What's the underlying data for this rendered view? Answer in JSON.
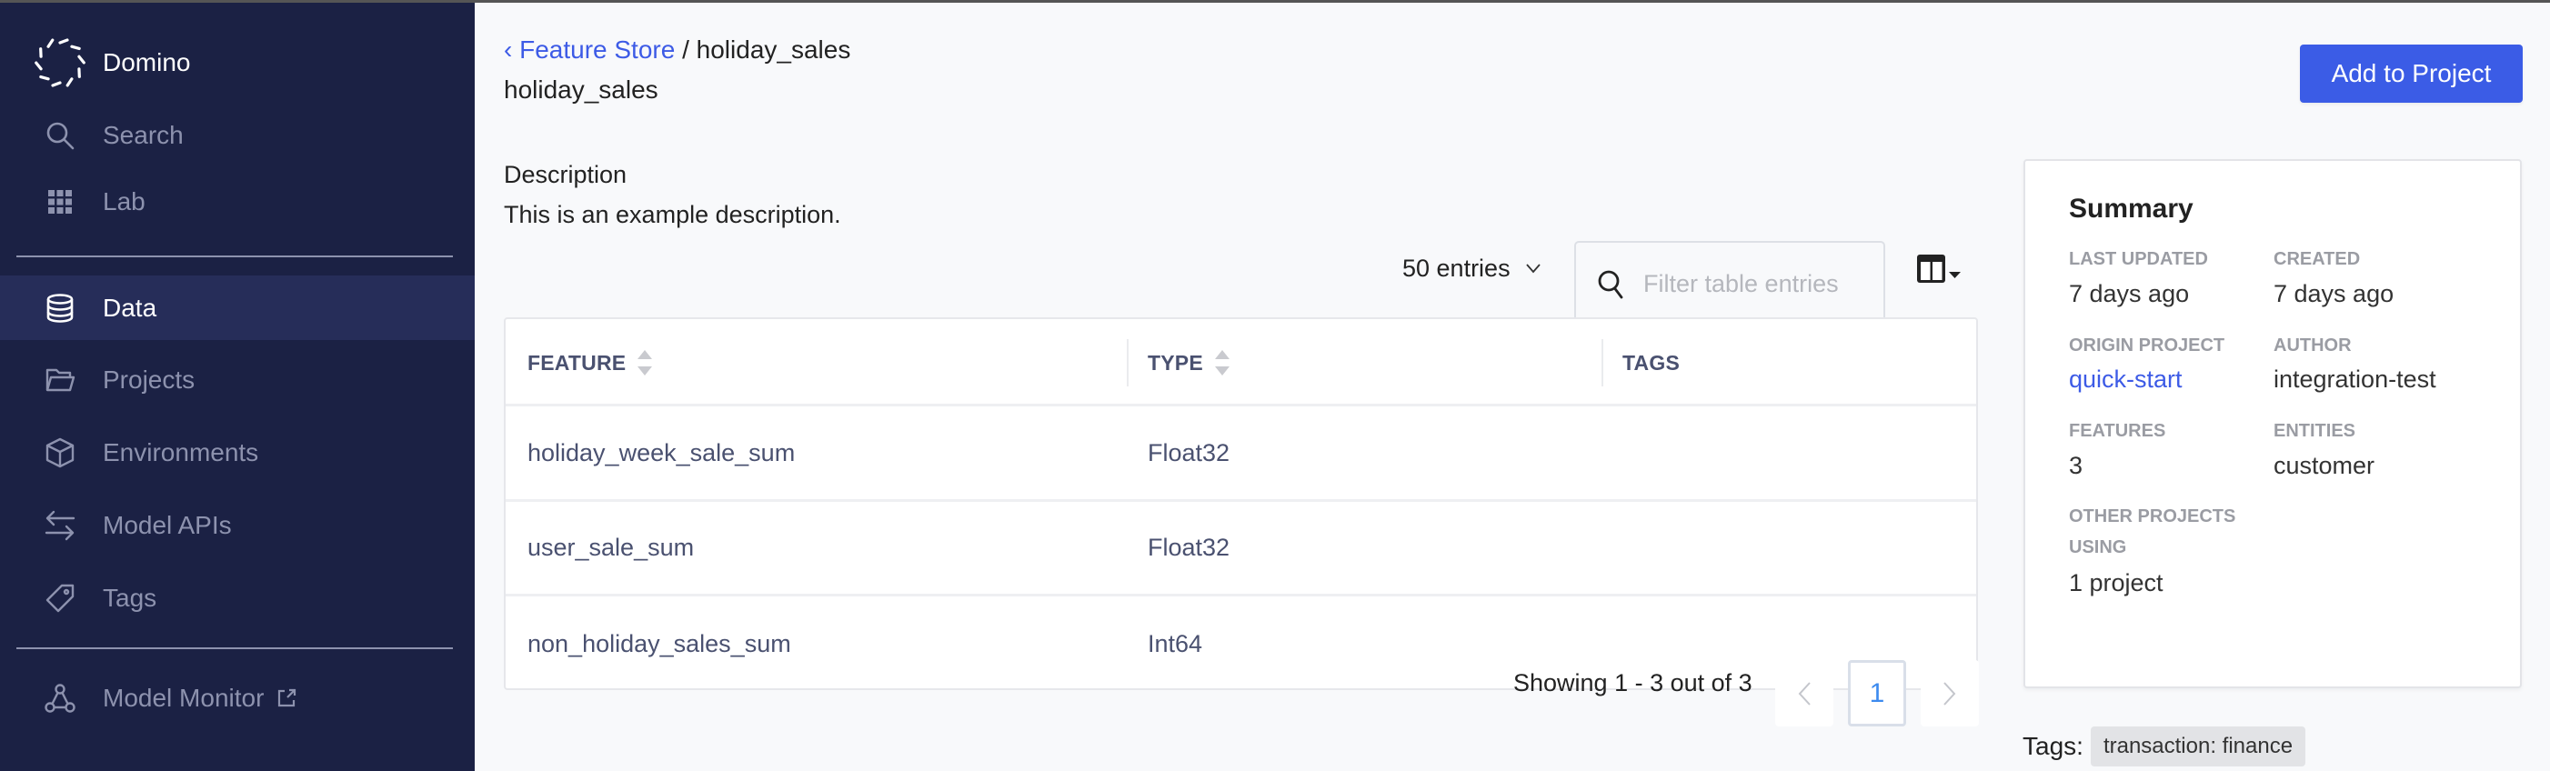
{
  "app": {
    "brand_name": "Domino",
    "brand_icon": "domino-logo-icon"
  },
  "sidebar": {
    "items": [
      {
        "label": "Search",
        "icon": "search-icon",
        "active": false
      },
      {
        "label": "Lab",
        "icon": "grid-icon",
        "active": false
      },
      {
        "label": "Data",
        "icon": "database-icon",
        "active": true
      },
      {
        "label": "Projects",
        "icon": "folder-icon",
        "active": false
      },
      {
        "label": "Environments",
        "icon": "cube-icon",
        "active": false
      },
      {
        "label": "Model APIs",
        "icon": "arrows-exchange-icon",
        "active": false
      },
      {
        "label": "Tags",
        "icon": "tag-icon",
        "active": false
      },
      {
        "label": "Model Monitor",
        "icon": "model-monitor-icon",
        "active": false,
        "external": true
      }
    ]
  },
  "header": {
    "breadcrumb_link": "‹ Feature Store",
    "breadcrumb_sep": " / ",
    "breadcrumb_current": "holiday_sales",
    "title": "holiday_sales",
    "add_button_label": "Add to Project"
  },
  "description": {
    "label": "Description",
    "text": "This is an example description."
  },
  "table_controls": {
    "entries_label": "50 entries",
    "filter_placeholder": "Filter table entries",
    "filter_value": ""
  },
  "table": {
    "columns": [
      {
        "label": "FEATURE",
        "sortable": true
      },
      {
        "label": "TYPE",
        "sortable": true
      },
      {
        "label": "TAGS",
        "sortable": false
      }
    ],
    "rows": [
      {
        "feature": "holiday_week_sale_sum",
        "type": "Float32",
        "tags": ""
      },
      {
        "feature": "user_sale_sum",
        "type": "Float32",
        "tags": ""
      },
      {
        "feature": "non_holiday_sales_sum",
        "type": "Int64",
        "tags": ""
      }
    ]
  },
  "pagination": {
    "showing_text": "Showing 1 - 3 out of 3",
    "prev_label": "‹",
    "current_page": "1",
    "next_label": "›"
  },
  "summary": {
    "title": "Summary",
    "fields": {
      "last_updated": {
        "label": "LAST UPDATED",
        "value": "7 days ago"
      },
      "created": {
        "label": "CREATED",
        "value": "7 days ago"
      },
      "origin_project": {
        "label": "ORIGIN PROJECT",
        "value": "quick-start"
      },
      "author": {
        "label": "AUTHOR",
        "value": "integration-test"
      },
      "features": {
        "label": "FEATURES",
        "value": "3"
      },
      "entities": {
        "label": "ENTITIES",
        "value": "customer"
      },
      "other_projects": {
        "label": "OTHER PROJECTS USING",
        "value": "1 project"
      }
    }
  },
  "tags": {
    "label": "Tags:",
    "items": [
      "transaction: finance"
    ]
  },
  "colors": {
    "sidebar_bg": "#1b2144",
    "sidebar_active_bg": "#262d59",
    "accent": "#3b5ce6",
    "link": "#3d5be6",
    "page_current": "#3d8bef"
  }
}
